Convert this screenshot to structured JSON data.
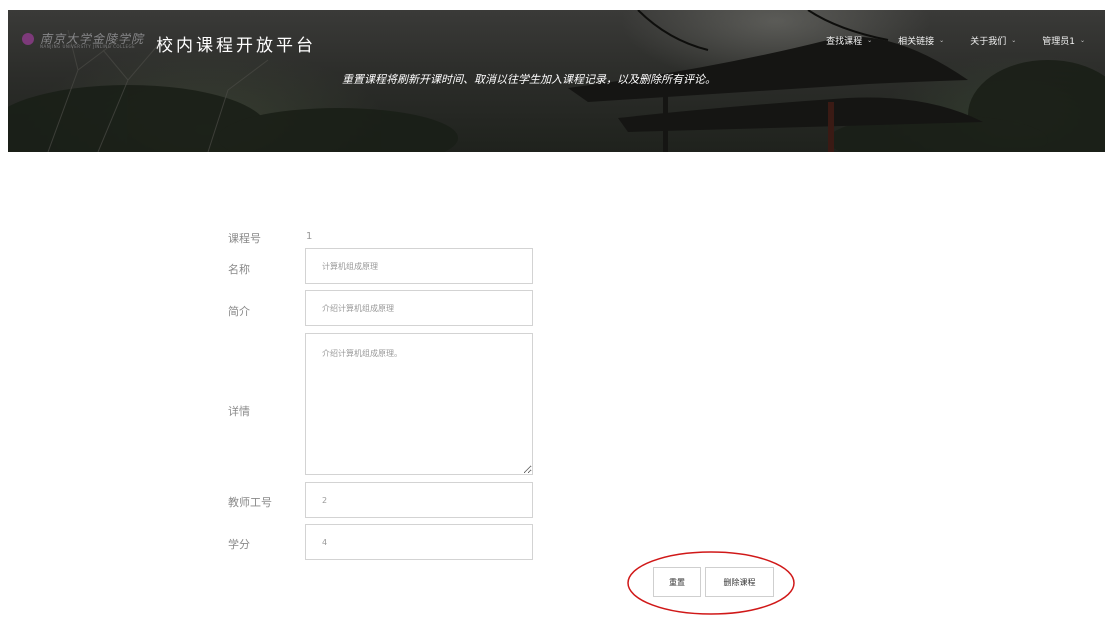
{
  "header": {
    "logo_text": "南京大学金陵学院",
    "logo_sub": "NANJING UNIVERSITY JINLING COLLEGE",
    "site_title": "校内课程开放平台",
    "notice": "重置课程将刷新开课时间、取消以往学生加入课程记录，以及删除所有评论。"
  },
  "nav": {
    "items": [
      {
        "label": "查找课程"
      },
      {
        "label": "相关链接"
      },
      {
        "label": "关于我们"
      },
      {
        "label": "管理员1"
      }
    ],
    "caret": "⌄"
  },
  "form": {
    "course_id_label": "课程号",
    "course_id_value": "1",
    "name_label": "名称",
    "name_value": "计算机组成原理",
    "intro_label": "简介",
    "intro_value": "介绍计算机组成原理",
    "detail_label": "详情",
    "detail_value": "介绍计算机组成原理。",
    "teacher_label": "教师工号",
    "teacher_value": "2",
    "credit_label": "学分",
    "credit_value": "4"
  },
  "actions": {
    "reset_label": "重置",
    "delete_label": "删除课程"
  },
  "colors": {
    "highlight": "#d01818"
  }
}
